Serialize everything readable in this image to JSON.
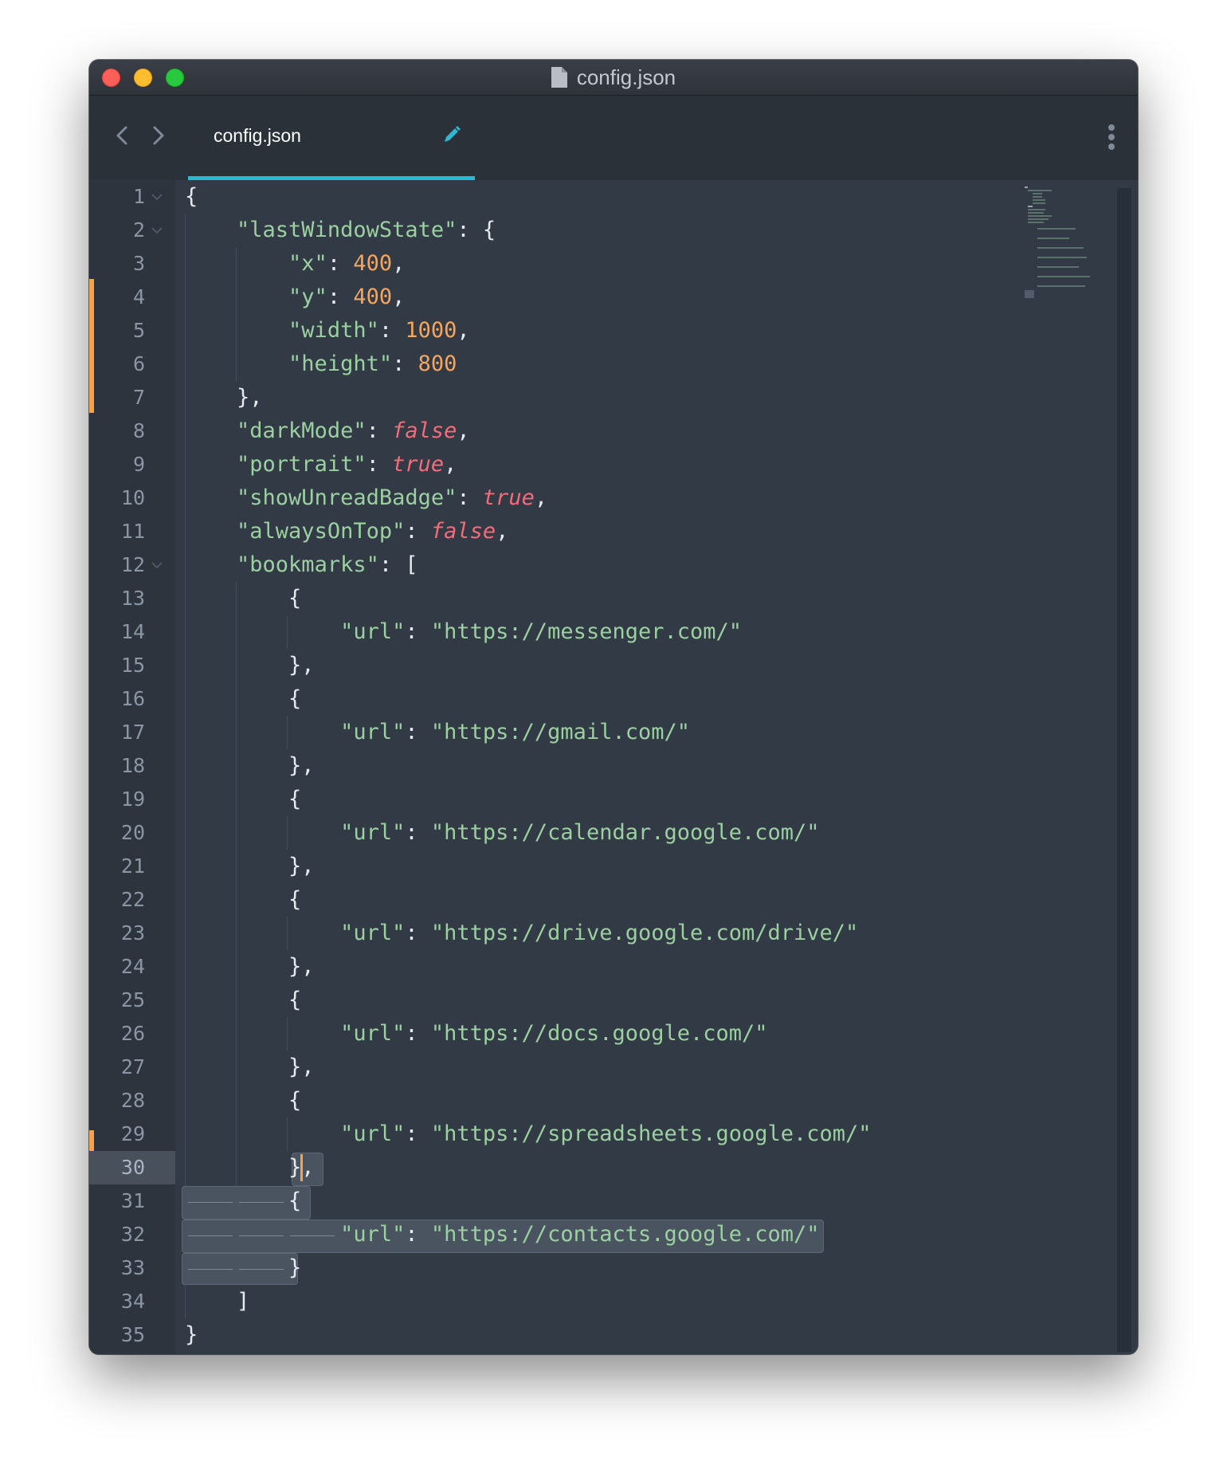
{
  "window": {
    "title": "config.json"
  },
  "tab": {
    "label": "config.json",
    "modified_icon": "pencil-icon"
  },
  "toolbar": {
    "back_icon": "chevron-left-icon",
    "forward_icon": "chevron-right-icon",
    "more_icon": "vertical-ellipsis-icon"
  },
  "editor": {
    "active_line": "30",
    "line_numbers": [
      "1",
      "2",
      "3",
      "4",
      "5",
      "6",
      "7",
      "8",
      "9",
      "10",
      "11",
      "12",
      "13",
      "14",
      "15",
      "16",
      "17",
      "18",
      "19",
      "20",
      "21",
      "22",
      "23",
      "24",
      "25",
      "26",
      "27",
      "28",
      "29",
      "30",
      "31",
      "32",
      "33",
      "34",
      "35"
    ],
    "code": {
      "open_brace": "{",
      "close_brace": "}",
      "close_brace_comma": "},",
      "open_bracket": "[",
      "close_bracket": "]",
      "colon": ": ",
      "comma": ",",
      "k_lastWindowState": "\"lastWindowState\"",
      "k_x": "\"x\"",
      "v_x": "400",
      "k_y": "\"y\"",
      "v_y": "400",
      "k_width": "\"width\"",
      "v_width": "1000",
      "k_height": "\"height\"",
      "v_height": "800",
      "k_darkMode": "\"darkMode\"",
      "v_darkMode": "false",
      "k_portrait": "\"portrait\"",
      "v_portrait": "true",
      "k_showUnreadBadge": "\"showUnreadBadge\"",
      "v_showUnreadBadge": "true",
      "k_alwaysOnTop": "\"alwaysOnTop\"",
      "v_alwaysOnTop": "false",
      "k_bookmarks": "\"bookmarks\"",
      "k_url": "\"url\"",
      "bookmarks": [
        "\"https://messenger.com/\"",
        "\"https://gmail.com/\"",
        "\"https://calendar.google.com/\"",
        "\"https://drive.google.com/drive/\"",
        "\"https://docs.google.com/\"",
        "\"https://spreadsheets.google.com/\"",
        "\"https://contacts.google.com/\""
      ]
    }
  },
  "colors": {
    "background": "#323a45",
    "gutter": "#2d343e",
    "key_string": "#9bd0a0",
    "number": "#f5a55d",
    "boolean": "#f46b7a",
    "accent": "#2fb6d0",
    "modified_marker": "#f4a34b"
  }
}
